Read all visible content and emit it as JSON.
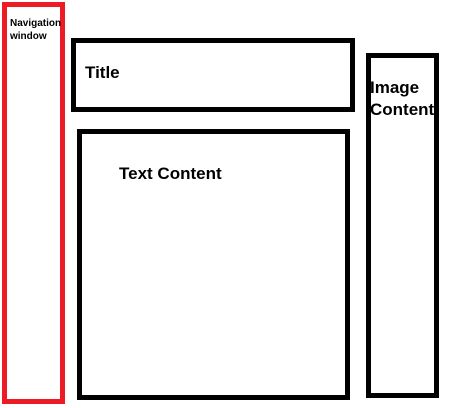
{
  "colors": {
    "navigation_border": "#ed1c24",
    "box_border": "#000000",
    "text": "#000000",
    "background": "#ffffff"
  },
  "navigation": {
    "label": "Navigation window"
  },
  "title_box": {
    "label": "Title"
  },
  "image_box": {
    "label": "Image Content"
  },
  "text_box": {
    "label": "Text Content"
  }
}
